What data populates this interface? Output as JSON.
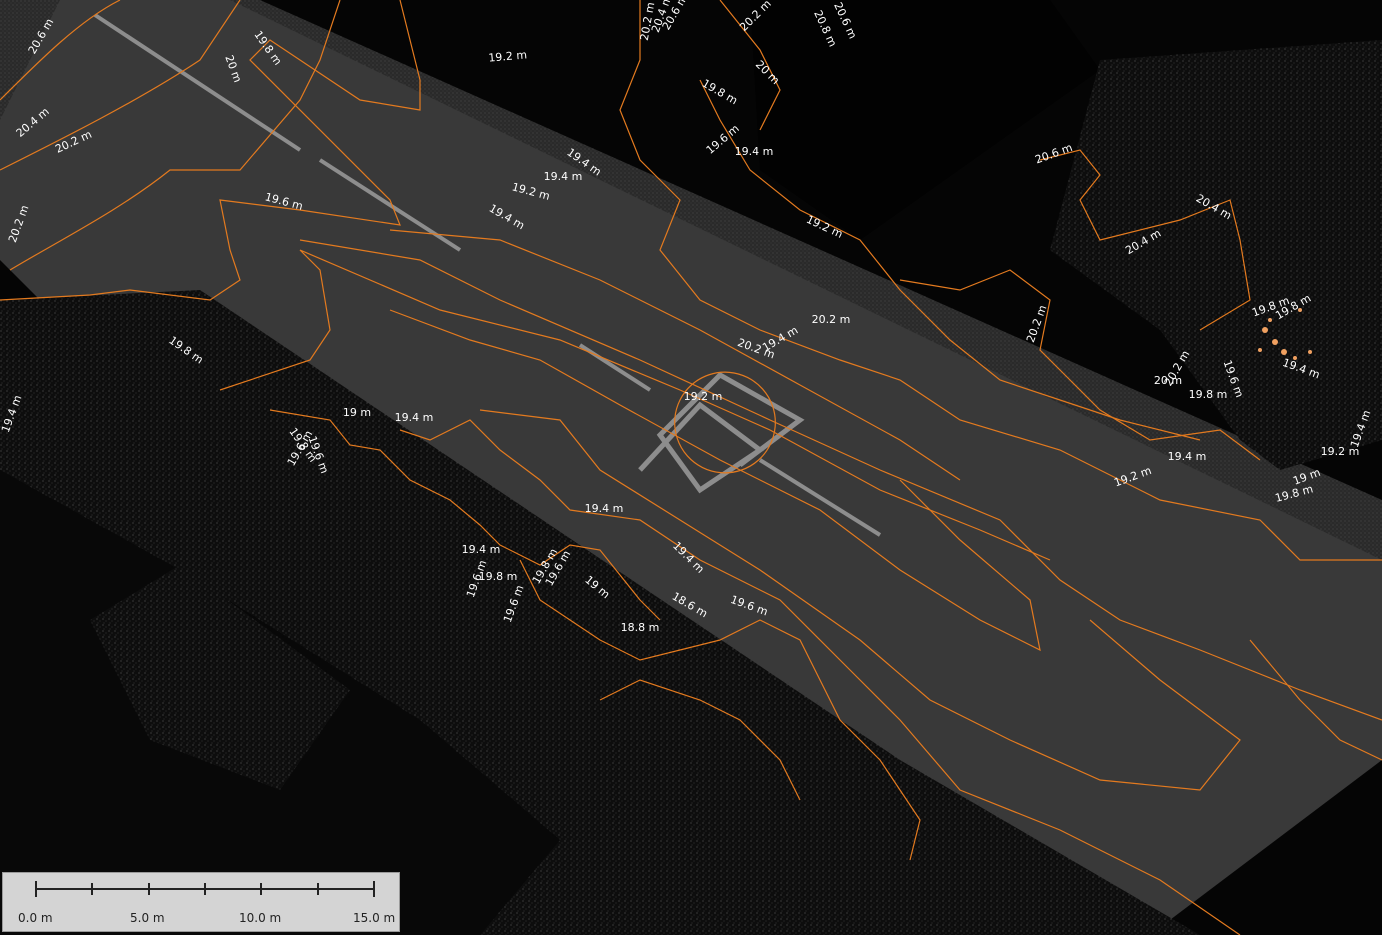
{
  "colors": {
    "background": "#000000",
    "road": "#3a3a3a",
    "contour": "#e37a1f",
    "label": "#ffffff",
    "scalebar_bg": "#d4d4d4"
  },
  "map": {
    "contour_labels": [
      "20.6 m",
      "19.8 m",
      "20 m",
      "20.4 m",
      "20.2 m",
      "20.2 m",
      "19.6 m",
      "19.2 m",
      "19.4 m",
      "19.2 m",
      "19.4 m",
      "19.4 m",
      "19.4 m",
      "19.8 m",
      "19.8 m",
      "20.2 m",
      "20.4 m",
      "20.6 m",
      "20 m",
      "20.2 m",
      "20.6 m",
      "20.8 m",
      "20.6 m",
      "20.4 m",
      "20.4 m",
      "19.8 m",
      "19.6 m",
      "19.4 m",
      "19.2 m",
      "20.2 m",
      "19.4 m",
      "20.2 m",
      "20.2 m",
      "20.2 m",
      "20 m",
      "19.6 m",
      "19.8 m",
      "19.8 m",
      "19.8 m",
      "19.4 m",
      "19.4 m",
      "19.2 m",
      "19.2 m",
      "19 m",
      "19.8 m",
      "19.4 m",
      "19.2 m",
      "19.4 m",
      "19 m",
      "19.4 m",
      "19.6 m",
      "19.6 m",
      "19.4 m",
      "19.6 m",
      "19.8 m",
      "19.6 m",
      "19.8 m",
      "19.6 m",
      "19 m",
      "18.8 m",
      "18.6 m",
      "19.6 m",
      "19.4 m"
    ]
  },
  "scalebar": {
    "labels": [
      "0.0 m",
      "5.0 m",
      "10.0 m",
      "15.0 m"
    ]
  }
}
